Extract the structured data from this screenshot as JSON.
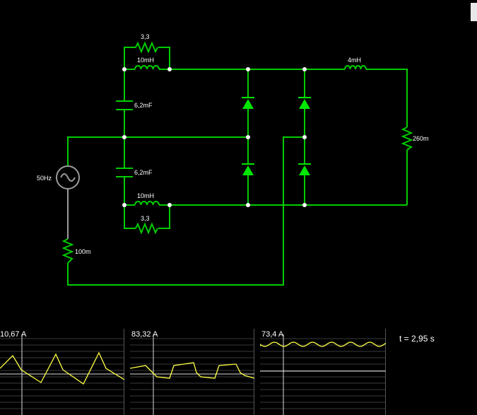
{
  "components": {
    "r_top": "3,3",
    "l_top": "10mH",
    "c_top": "6,2mF",
    "c_bottom": "6,2mF",
    "l_bottom": "10mH",
    "r_bottom": "3,3",
    "l_load": "4mH",
    "r_load": "260m",
    "source": "50Hz",
    "r_source": "100m"
  },
  "scopes": [
    {
      "value": "10,67 A",
      "wave": "sawtooth"
    },
    {
      "value": "83,32 A",
      "wave": "square"
    },
    {
      "value": "73,4 A",
      "wave": "ripple"
    }
  ],
  "time": "t = 2,95 s",
  "colors": {
    "wire": "#00cc00",
    "diode": "#00e600",
    "node": "#ffffff",
    "trace": "#ffff44",
    "grid": "#3a3a3a"
  }
}
